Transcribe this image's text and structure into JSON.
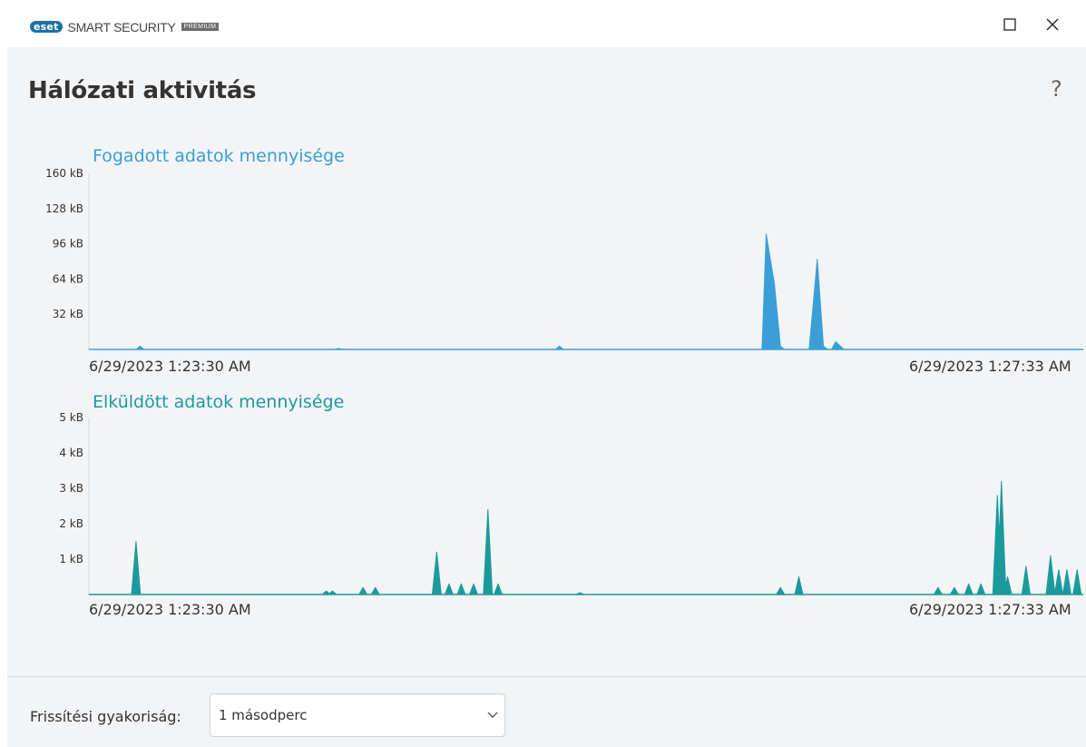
{
  "app": {
    "brand_badge": "eset",
    "brand_name": "SMART SECURITY",
    "brand_edition": "PREMIUM"
  },
  "window_controls": {
    "maximize_icon": "maximize-icon",
    "close_icon": "close-icon"
  },
  "page": {
    "title": "Hálózati aktivitás",
    "help": "?"
  },
  "chart_data": [
    {
      "type": "area",
      "title": "Fogadott adatok mennyisége",
      "ylabel": "",
      "xlabel": "",
      "y_ticks": [
        "32 kB",
        "64 kB",
        "96 kB",
        "128 kB",
        "160 kB"
      ],
      "ylim": [
        0,
        160
      ],
      "y_unit": "kB",
      "x_start_label": "6/29/2023 1:23:30 AM",
      "x_end_label": "6/29/2023 1:27:33 AM",
      "color": "#3a9fd6",
      "x": [
        0,
        23,
        25,
        27,
        30,
        100,
        120,
        122,
        124,
        200,
        228,
        230,
        232,
        280,
        320,
        329,
        331,
        335,
        338,
        340,
        344,
        348,
        352,
        356,
        359,
        361,
        363,
        365,
        369,
        380,
        400,
        486
      ],
      "values": [
        0,
        0,
        3,
        0,
        0,
        0,
        0,
        1,
        0,
        0,
        0,
        3,
        0,
        0,
        0,
        0,
        105,
        60,
        3,
        0,
        0,
        0,
        0,
        82,
        3,
        0,
        0,
        7,
        0,
        0,
        0,
        0
      ]
    },
    {
      "type": "area",
      "title": "Elküldött adatok mennyisége",
      "ylabel": "",
      "xlabel": "",
      "y_ticks": [
        "1 kB",
        "2 kB",
        "3 kB",
        "4 kB",
        "5 kB"
      ],
      "ylim": [
        0,
        5
      ],
      "y_unit": "kB",
      "x_start_label": "6/29/2023 1:23:30 AM",
      "x_end_label": "6/29/2023 1:27:33 AM",
      "color": "#1b9a9c",
      "x": [
        0,
        22,
        24,
        26,
        60,
        62,
        64,
        66,
        68,
        70,
        82,
        84,
        86,
        88,
        90,
        92,
        94,
        96,
        98,
        100,
        102,
        104,
        106,
        108,
        112,
        115,
        118,
        125,
        170,
        172,
        174,
        176,
        178,
        200,
        208,
        210,
        212,
        214,
        218,
        220,
        222,
        225,
        228,
        231,
        234,
        236,
        239,
        242,
        300,
        301,
        302,
        303,
        304,
        306,
        308,
        310,
        318,
        321,
        323,
        325,
        327,
        329,
        331,
        333,
        335,
        339,
        341,
        343,
        345,
        347,
        349,
        351,
        353,
        355,
        357,
        359,
        361,
        363,
        366,
        369,
        371,
        373,
        375,
        377,
        379,
        381,
        383,
        385,
        387,
        390,
        392,
        393,
        394,
        396,
        398,
        399,
        400,
        402,
        405,
        408,
        410,
        412,
        414,
        416,
        418,
        420,
        422,
        424,
        426,
        428,
        430,
        432,
        434,
        436,
        438,
        440,
        442,
        444,
        446,
        448,
        450,
        452,
        454,
        456,
        458,
        460,
        462,
        464,
        466,
        468,
        470,
        472,
        474,
        476,
        478,
        480,
        482,
        484,
        486
      ],
      "values": [
        0,
        0,
        1.5,
        0,
        0,
        0.05,
        0,
        0.05,
        0,
        0.2,
        0.2,
        0,
        0,
        1.2,
        0,
        0.3,
        0,
        0.3,
        0,
        0.3,
        0,
        2.4,
        0,
        0.3,
        0,
        0,
        0,
        0,
        0,
        0.05,
        0,
        0,
        0,
        0,
        0.2,
        0,
        0.5,
        0,
        0,
        0,
        0,
        0,
        0,
        0,
        0,
        0,
        0,
        0,
        0,
        0,
        0,
        0,
        0,
        0,
        0,
        0,
        0,
        0,
        0,
        0,
        0,
        0,
        0,
        0,
        0,
        0,
        0,
        0,
        0,
        0,
        0,
        0,
        0,
        0,
        0,
        0,
        0,
        0,
        0,
        0,
        0,
        0,
        0,
        0,
        0,
        0,
        0,
        0,
        0,
        0,
        0,
        0,
        0,
        0,
        0,
        0,
        0,
        0,
        0,
        0,
        0,
        0,
        0,
        0,
        0,
        0,
        0,
        0,
        0,
        0,
        0,
        0,
        0,
        0,
        0,
        0,
        0,
        0,
        0,
        0,
        0,
        0,
        0,
        0,
        0,
        0,
        0,
        0,
        0,
        0,
        0,
        0,
        0,
        0,
        0,
        0,
        0,
        0,
        0,
        0
      ],
      "peaks": [
        {
          "x": 23,
          "v": 1.5
        },
        {
          "x": 116,
          "v": 0.1
        },
        {
          "x": 119,
          "v": 0.1
        },
        {
          "x": 134,
          "v": 0.2
        },
        {
          "x": 140,
          "v": 0.2
        },
        {
          "x": 170,
          "v": 1.2
        },
        {
          "x": 176,
          "v": 0.3
        },
        {
          "x": 182,
          "v": 0.3
        },
        {
          "x": 188,
          "v": 0.3
        },
        {
          "x": 195,
          "v": 2.4
        },
        {
          "x": 200,
          "v": 0.3
        },
        {
          "x": 240,
          "v": 0.05
        },
        {
          "x": 338,
          "v": 0.2
        },
        {
          "x": 347,
          "v": 0.5
        },
        {
          "x": 415,
          "v": 0.2
        },
        {
          "x": 423,
          "v": 0.2
        },
        {
          "x": 430,
          "v": 0.3
        },
        {
          "x": 436,
          "v": 0.3
        },
        {
          "x": 444,
          "v": 2.8
        },
        {
          "x": 446,
          "v": 3.2
        },
        {
          "x": 449,
          "v": 0.5
        },
        {
          "x": 458,
          "v": 0.8
        },
        {
          "x": 470,
          "v": 1.1
        },
        {
          "x": 474,
          "v": 0.7
        },
        {
          "x": 478,
          "v": 0.7
        },
        {
          "x": 483,
          "v": 0.7
        }
      ]
    }
  ],
  "footer": {
    "frequency_label": "Frissítési gyakoriság:",
    "frequency_value": "1 másodperc"
  }
}
